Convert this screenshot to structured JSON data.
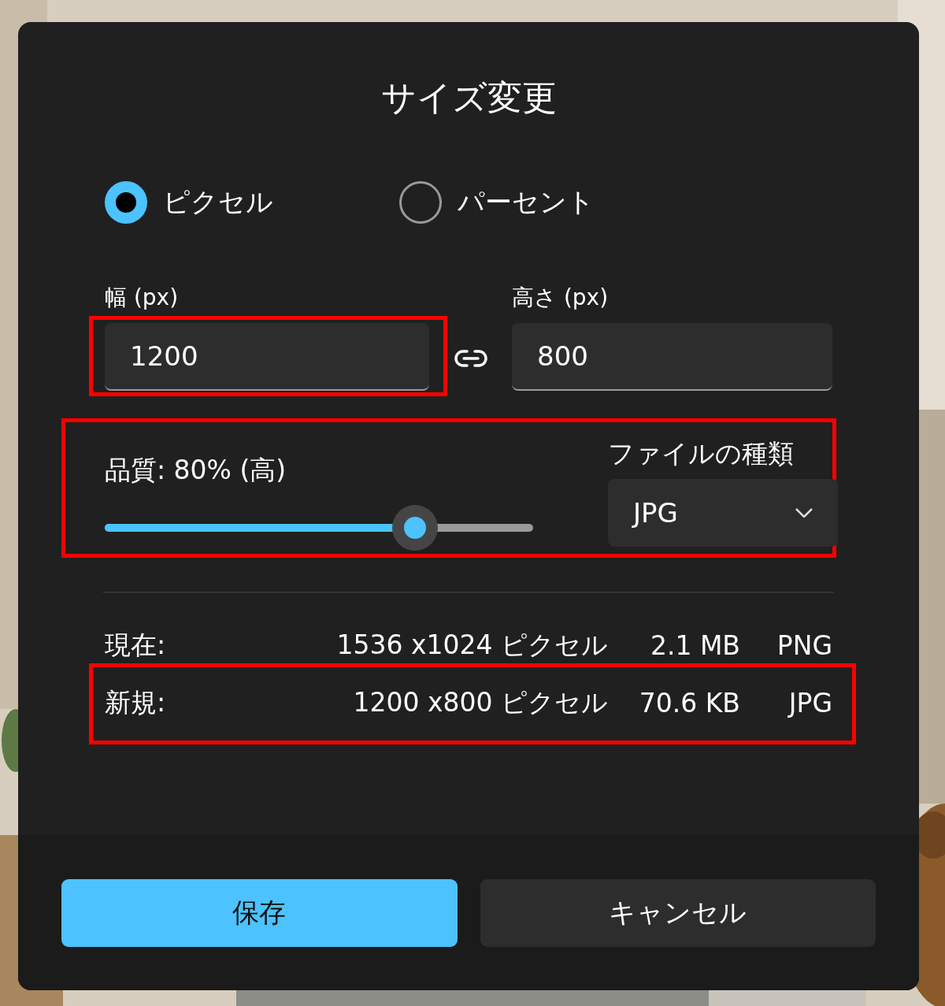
{
  "dialog": {
    "title": "サイズ変更"
  },
  "units": [
    {
      "label": "ピクセル",
      "selected": true
    },
    {
      "label": "パーセント",
      "selected": false
    }
  ],
  "fields": [
    {
      "label": "幅 (px)",
      "value": "1200",
      "highlighted": true
    },
    {
      "label": "高さ (px)",
      "value": "800",
      "highlighted": false
    }
  ],
  "quality": {
    "label": "品質: 80% (高)",
    "level": 0.75,
    "highlighted": true
  },
  "file_type": {
    "label": "ファイルの種類",
    "value": "JPG"
  },
  "info_rows": [
    {
      "label": "現在:",
      "dimensions": "1536 x1024 ピクセル",
      "size": "2.1 MB",
      "type": "PNG",
      "highlighted": false
    },
    {
      "label": "新規:",
      "dimensions": "1200 x800 ピクセル",
      "size": "70.6 KB",
      "type": "JPG",
      "highlighted": true
    }
  ],
  "buttons": [
    {
      "label": "保存",
      "kind": "primary"
    },
    {
      "label": "キャンセル",
      "kind": "secondary"
    }
  ]
}
